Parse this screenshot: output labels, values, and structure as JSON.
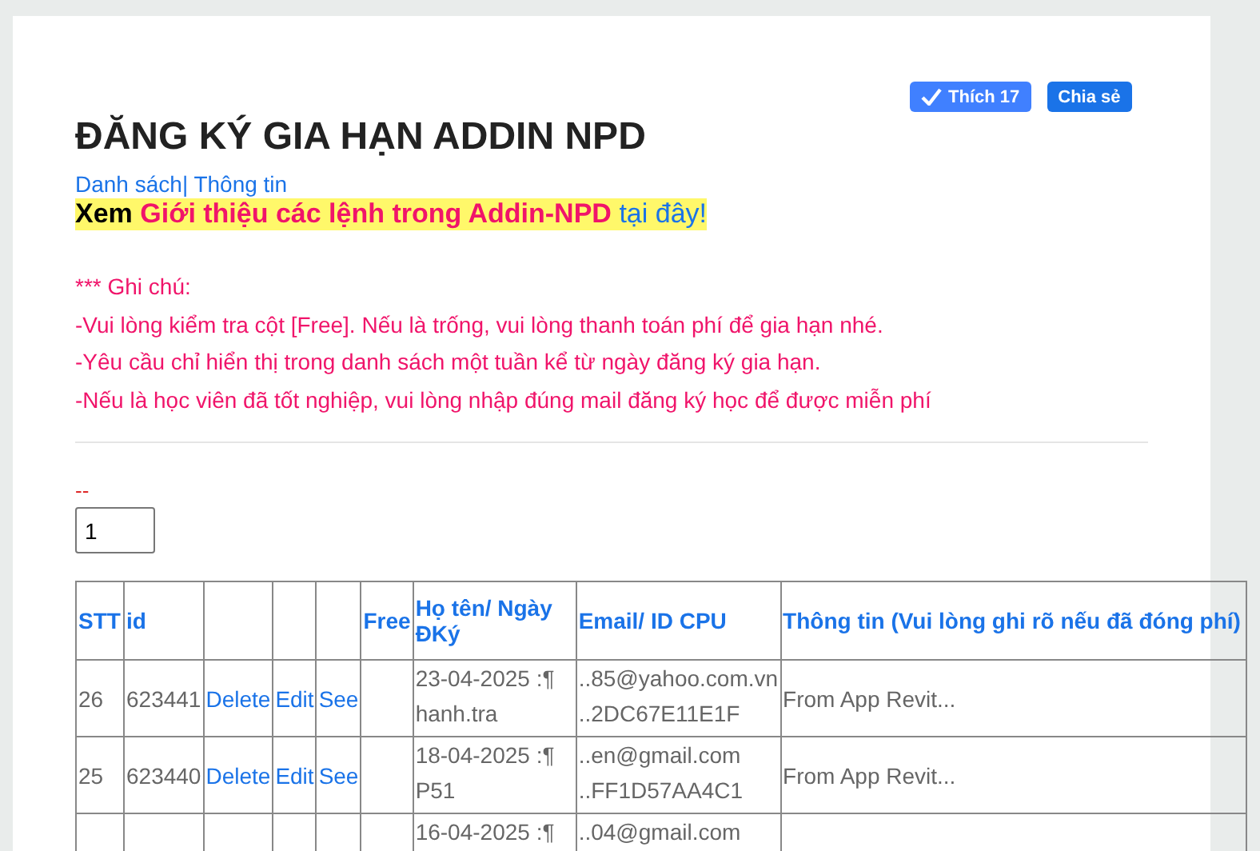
{
  "share_buttons": {
    "like": {
      "label": "Thích 17"
    },
    "share": {
      "label": "Chia sẻ"
    }
  },
  "title": "ĐĂNG KÝ GIA HẠN ADDIN NPD",
  "nav_links": [
    "Danh sách",
    "| Thông tin"
  ],
  "promo": {
    "lead": "Xem",
    "highlight": "Giới thiệu các lệnh trong Addin-NPD",
    "link": "tại đây!"
  },
  "notes": {
    "heading": "*** Ghi chú:",
    "lines": [
      "-Vui lòng kiểm tra cột [Free]. Nếu là trống, vui lòng thanh toán phí để gia hạn nhé.",
      "-Yêu cầu chỉ hiển thị trong danh sách một tuần kể từ ngày đăng ký gia hạn.",
      "-Nếu là học viên đã tốt nghiệp, vui lòng nhập đúng mail đăng ký học để được miễn phí"
    ]
  },
  "filter": {
    "label": "--",
    "value": "1"
  },
  "table": {
    "columns": [
      "STT",
      "id",
      "",
      "",
      "",
      "Free",
      "Họ tên/ Ngày ĐKý",
      "Email/ ID CPU",
      "Thông tin (Vui lòng ghi rõ nếu đã đóng phí)"
    ],
    "rows": [
      {
        "stt": "26",
        "id": "623441",
        "actions": [
          "Delete",
          "Edit",
          "See"
        ],
        "name_date": [
          "23-04-2025 :¶",
          "hanh.tra"
        ],
        "email_cpu": [
          "..85@yahoo.com.vn",
          "..2DC67E11E1F"
        ],
        "info": "From App Revit..."
      },
      {
        "stt": "25",
        "id": "623440",
        "actions": [
          "Delete",
          "Edit",
          "See"
        ],
        "name_date": [
          "18-04-2025 :¶",
          "P51"
        ],
        "email_cpu": [
          "..en@gmail.com",
          "..FF1D57AA4C1"
        ],
        "info": "From App Revit..."
      },
      {
        "name_date": [
          "16-04-2025 :¶"
        ],
        "email_cpu": [
          "..04@gmail.com"
        ]
      }
    ]
  }
}
